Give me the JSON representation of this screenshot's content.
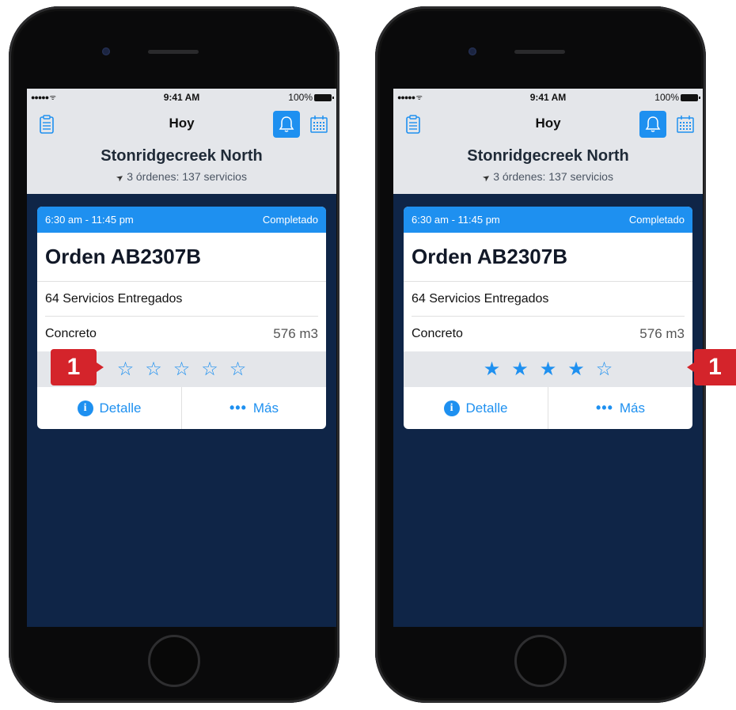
{
  "accent_color": "#1e90f0",
  "callout_color": "#d4242b",
  "screens": [
    {
      "status": {
        "signal": "●●●●● ᯤ",
        "time": "9:41 AM",
        "battery": "100%"
      },
      "nav": {
        "title": "Hoy",
        "left_icon": "clipboard-icon",
        "bell_icon": "bell-icon",
        "calendar_icon": "calendar-icon"
      },
      "site": {
        "name": "Stonridgecreek North",
        "summary": "3 órdenes: 137 servicios"
      },
      "card": {
        "time_range": "6:30 am - 11:45 pm",
        "status": "Completado",
        "order": "Orden AB2307B",
        "services": "64 Servicios Entregados",
        "material": "Concreto",
        "volume": "576 m3",
        "rating": 0,
        "rating_max": 5,
        "detail_label": "Detalle",
        "more_label": "Más"
      },
      "callout": "1"
    },
    {
      "status": {
        "signal": "●●●●● ᯤ",
        "time": "9:41 AM",
        "battery": "100%"
      },
      "nav": {
        "title": "Hoy",
        "left_icon": "clipboard-icon",
        "bell_icon": "bell-icon",
        "calendar_icon": "calendar-icon"
      },
      "site": {
        "name": "Stonridgecreek North",
        "summary": "3 órdenes: 137 servicios"
      },
      "card": {
        "time_range": "6:30 am - 11:45 pm",
        "status": "Completado",
        "order": "Orden AB2307B",
        "services": "64 Servicios Entregados",
        "material": "Concreto",
        "volume": "576 m3",
        "rating": 4,
        "rating_max": 5,
        "detail_label": "Detalle",
        "more_label": "Más"
      },
      "callout": "1"
    }
  ]
}
